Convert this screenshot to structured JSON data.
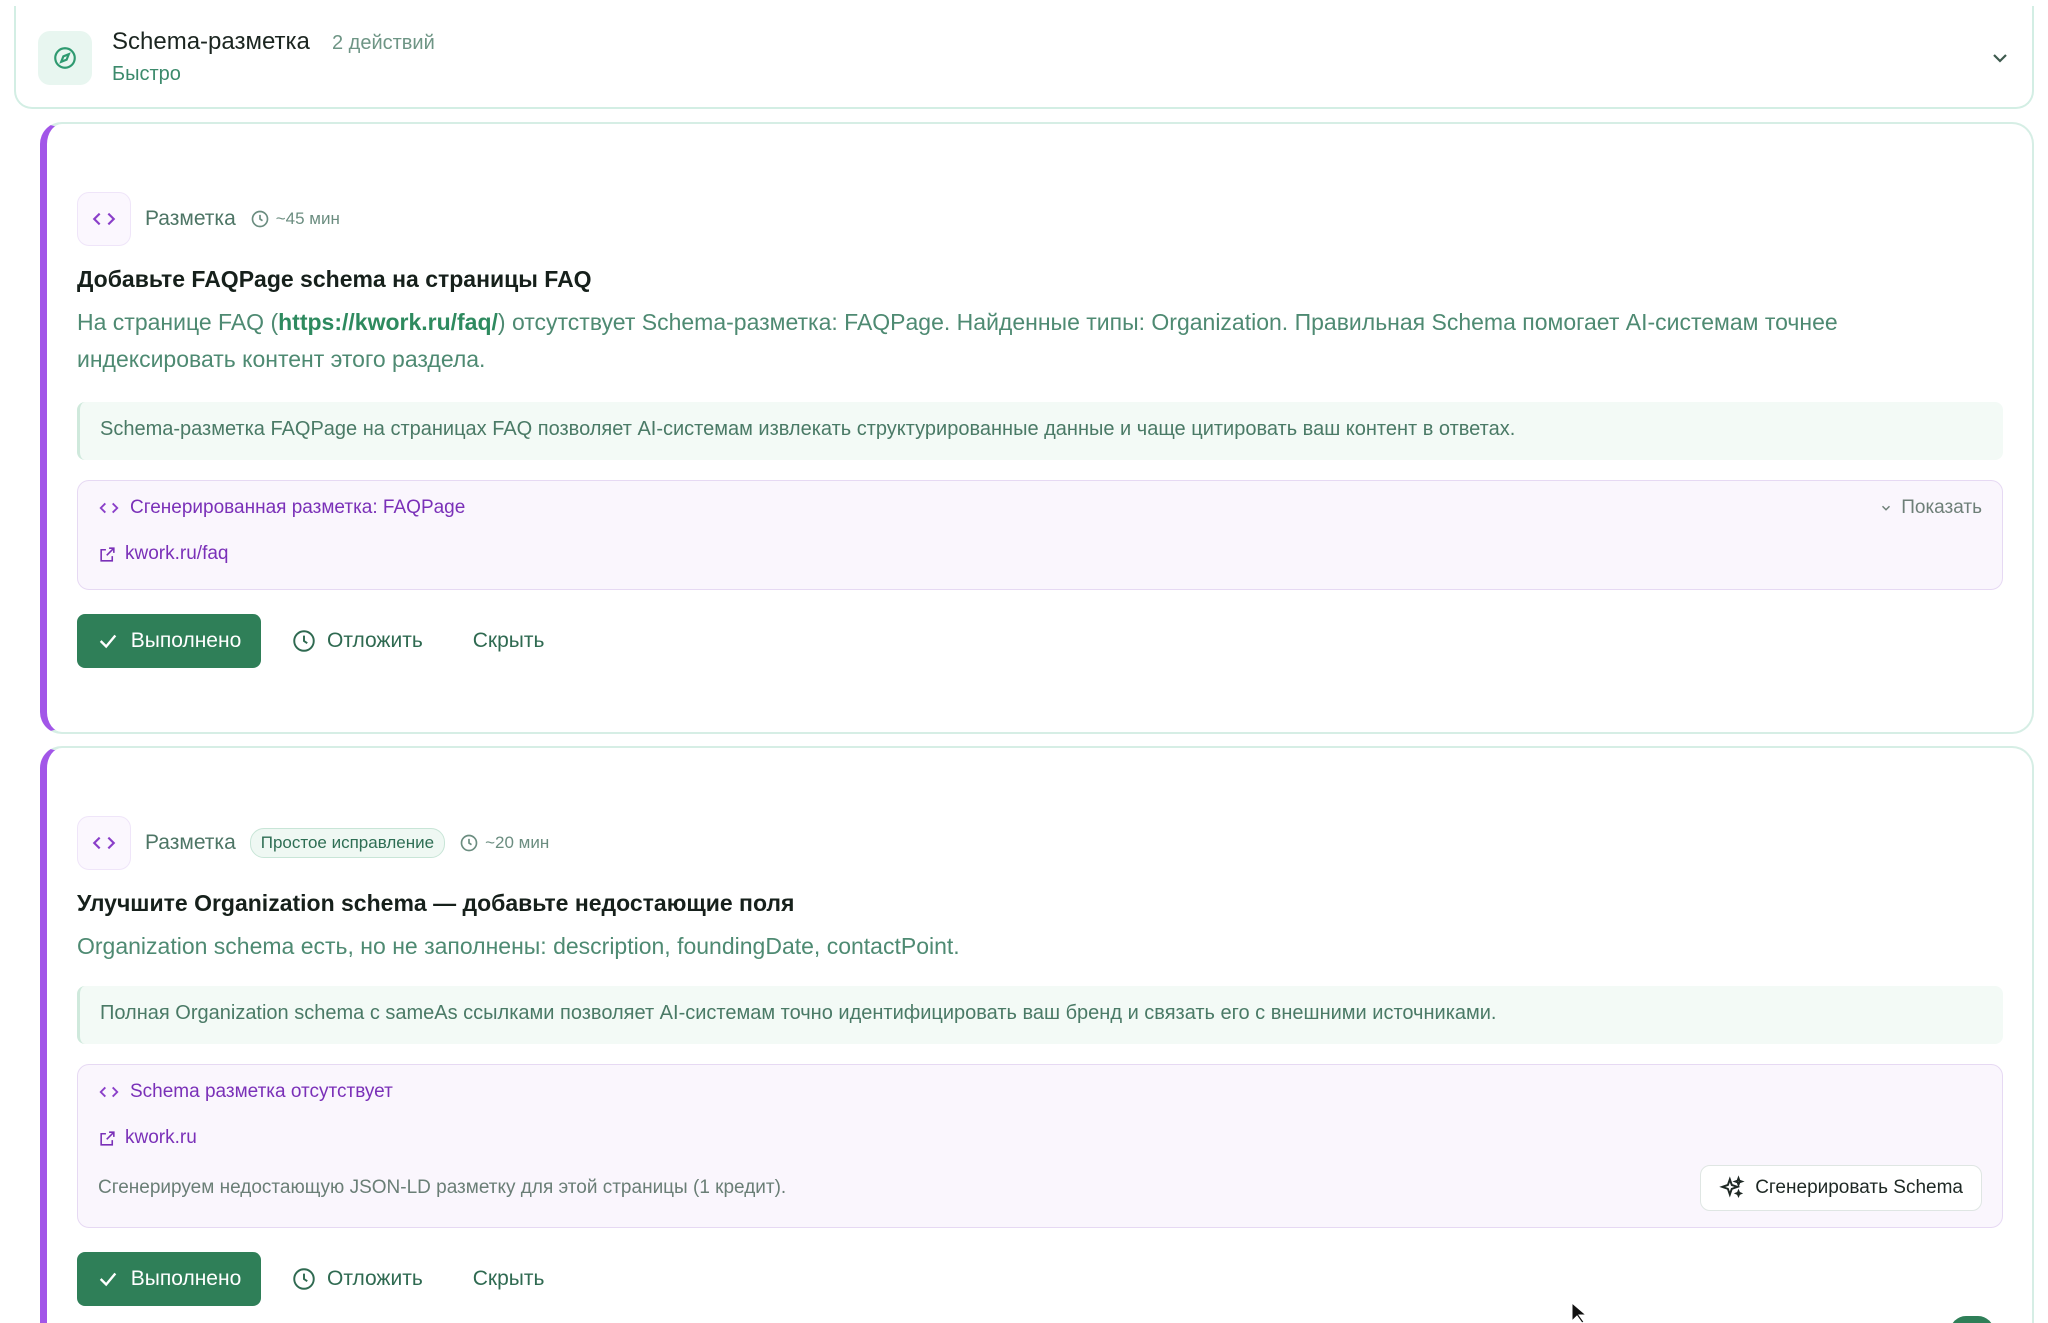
{
  "section": {
    "title": "Schema-разметка",
    "count": "2 действий",
    "speed": "Быстро",
    "icon": "compass-icon"
  },
  "cards": [
    {
      "category": "Разметка",
      "time": "~45 мин",
      "title": "Добавьте FAQPage schema на страницы FAQ",
      "desc_before": "На странице FAQ (",
      "desc_link": "https://kwork.ru/faq/",
      "desc_after": ") отсутствует Schema-разметка: FAQPage. Найденные типы: Organization. Правильная Schema помогает AI-системам точнее индексировать контент этого раздела.",
      "note": "Schema-разметка FAQPage на страницах FAQ позволяет AI-системам извлекать структурированные данные и чаще цитировать ваш контент в ответах.",
      "schema_title": "Сгенерированная разметка: FAQPage",
      "schema_show": "Показать",
      "schema_url": "kwork.ru/faq",
      "done_label": "Выполнено",
      "later_label": "Отложить",
      "hide_label": "Скрыть"
    },
    {
      "category": "Разметка",
      "badge": "Простое исправление",
      "time": "~20 мин",
      "title": "Улучшите Organization schema — добавьте недостающие поля",
      "desc": "Organization schema есть, но не заполнены: description, foundingDate, contactPoint.",
      "note": "Полная Organization schema с sameAs ссылками позволяет AI-системам точно идентифицировать ваш бренд и связать его с внешними источниками.",
      "schema_title": "Schema разметка отсутствует",
      "schema_url": "kwork.ru",
      "schema_hint": "Сгенерируем недостающую JSON-LD разметку для этой страницы (1 кредит).",
      "generate_label": "Сгенерировать Schema",
      "done_label": "Выполнено",
      "later_label": "Отложить",
      "hide_label": "Скрыть"
    }
  ],
  "colors": {
    "accent_purple": "#a256e8",
    "done_green": "#2f7f58",
    "text_green": "#4e8a72"
  }
}
